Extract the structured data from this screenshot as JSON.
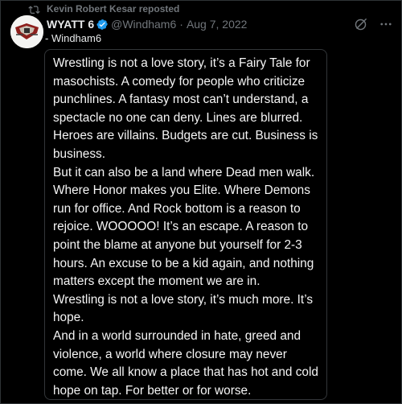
{
  "repost": {
    "icon": "repost-icon",
    "text": "Kevin Robert Kesar reposted"
  },
  "post": {
    "avatar": "avatar",
    "display_name": "WYATT 6",
    "verified_icon": "verified-badge-icon",
    "handle": "@Windham6",
    "separator": "·",
    "date": "Aug 7, 2022",
    "signature": "- Windham6",
    "top_icons": [
      "grok-icon",
      "more-icon"
    ],
    "note_lines": [
      "Wrestling is not a love story, it’s a Fairy Tale for",
      "masochists. A comedy for people who criticize",
      "punchlines. A fantasy most can’t understand, a",
      "spectacle no one can deny. Lines are blurred.",
      "Heroes are villains. Budgets are cut. Business is",
      "business.",
      "But it can also be a land where Dead men walk.",
      "Where Honor makes you Elite. Where Demons",
      "run for office. And Rock bottom is a reason to",
      "rejoice. WOOOOO! It’s an escape. A reason to",
      "point the blame at anyone but yourself for 2-3",
      "hours. An excuse to be a kid again, and nothing",
      "matters except the moment we are in.",
      "Wrestling is not a love story, it’s much more. It’s",
      "hope.",
      "And in a world surrounded in hate, greed and",
      "violence, a world where closure may never",
      "come. We all know a place that has hot and cold",
      "hope on tap. For better or for worse."
    ]
  },
  "colors": {
    "background": "#000000",
    "text": "#e7e9ea",
    "muted": "#71767b",
    "verified": "#1d9bf0",
    "border": "#333639"
  }
}
